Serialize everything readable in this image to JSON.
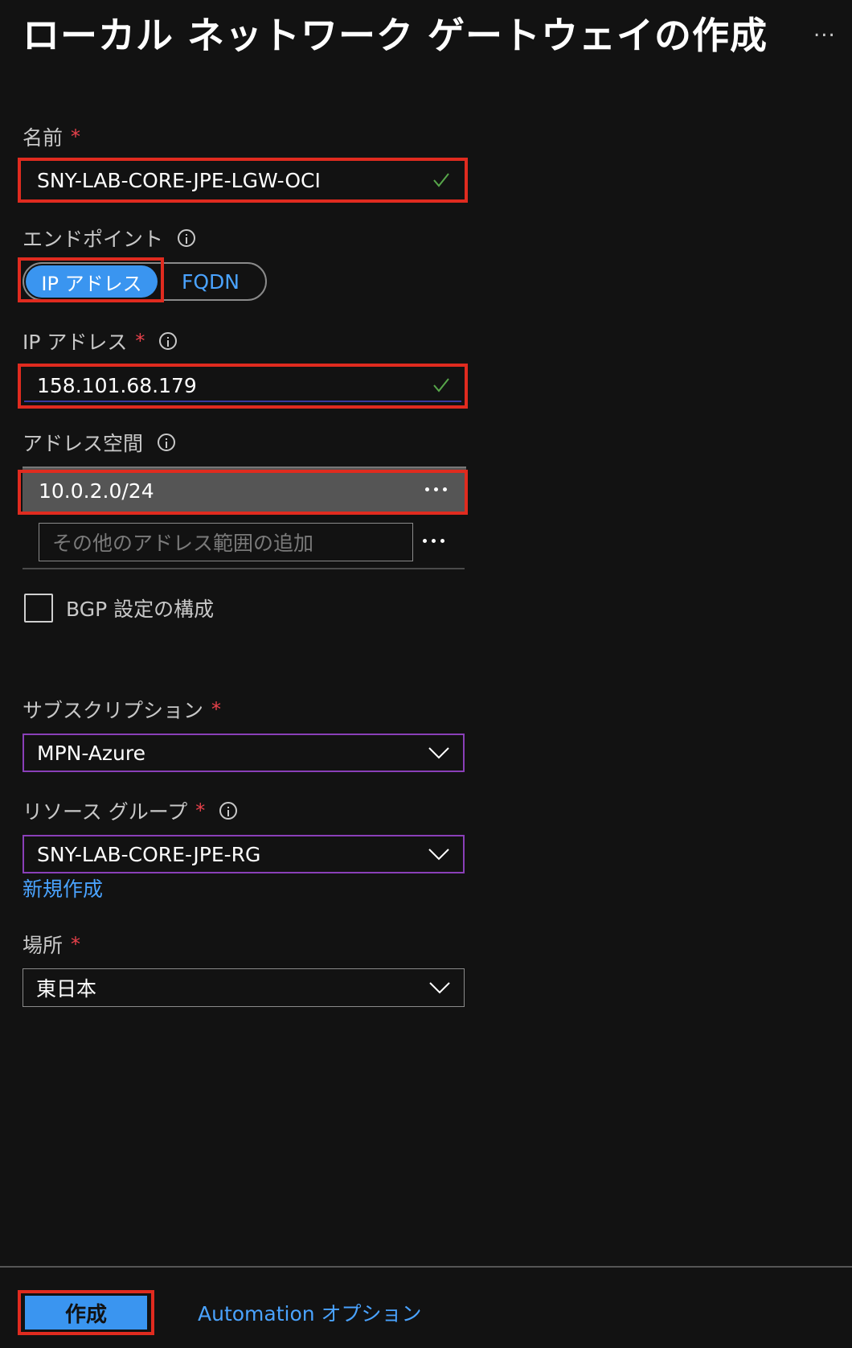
{
  "header": {
    "title": "ローカル ネットワーク ゲートウェイの作成",
    "more": "..."
  },
  "form": {
    "name": {
      "label": "名前",
      "required_mark": "*",
      "value": "SNY-LAB-CORE-JPE-LGW-OCI"
    },
    "endpoint": {
      "label": "エンドポイント",
      "options": [
        "IP アドレス",
        "FQDN"
      ],
      "selected": "IP アドレス"
    },
    "ip_address": {
      "label": "IP アドレス",
      "required_mark": "*",
      "value": "158.101.68.179"
    },
    "address_space": {
      "label": "アドレス空間",
      "entries": [
        "10.0.2.0/24"
      ],
      "add_placeholder": "その他のアドレス範囲の追加"
    },
    "bgp": {
      "label": "BGP 設定の構成",
      "checked": false
    },
    "subscription": {
      "label": "サブスクリプション",
      "required_mark": "*",
      "value": "MPN-Azure"
    },
    "resource_group": {
      "label": "リソース グループ",
      "required_mark": "*",
      "value": "SNY-LAB-CORE-JPE-RG",
      "create_new_link": "新規作成"
    },
    "location": {
      "label": "場所",
      "required_mark": "*",
      "value": "東日本"
    }
  },
  "footer": {
    "create_label": "作成",
    "automation_label": "Automation オプション"
  },
  "colors": {
    "background": "#121212",
    "accent": "#3a95f0",
    "link": "#4aa3ff",
    "required": "#e8414b",
    "valid_check": "#57a64a",
    "highlight_box": "#e02b1f",
    "dropdown_focus": "#8a3fb8"
  }
}
